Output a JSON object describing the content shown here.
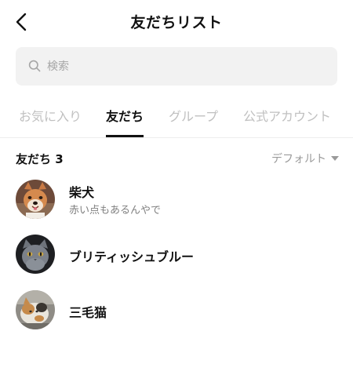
{
  "header": {
    "title": "友だちリスト",
    "back_icon": "back-chevron-icon"
  },
  "search": {
    "placeholder": "検索",
    "icon": "search-icon"
  },
  "tabs": [
    {
      "label": "お気に入り",
      "active": false
    },
    {
      "label": "友だち",
      "active": true
    },
    {
      "label": "グループ",
      "active": false
    },
    {
      "label": "公式アカウント",
      "active": false
    }
  ],
  "list": {
    "count_label": "友だち 3",
    "sort_label": "デフォルト"
  },
  "friends": [
    {
      "name": "柴犬",
      "status": "赤い点もあるんやで",
      "avatar": "shiba-dog-photo"
    },
    {
      "name": "ブリティッシュブルー",
      "status": "",
      "avatar": "gray-cat-photo"
    },
    {
      "name": "三毛猫",
      "status": "",
      "avatar": "calico-cat-photo"
    }
  ],
  "colors": {
    "background": "#ffffff",
    "search_bg": "#f2f2f2",
    "inactive_tab": "#c0c0c0",
    "muted_text": "#808080",
    "text": "#111111"
  }
}
